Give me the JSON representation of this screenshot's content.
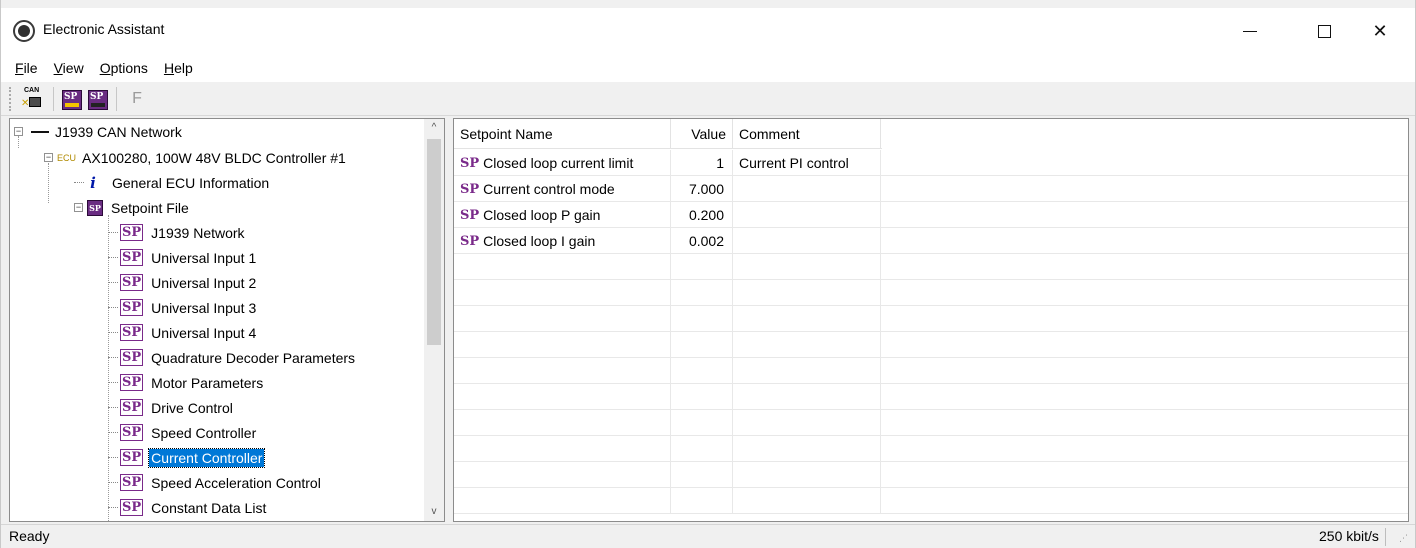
{
  "window": {
    "title": "Electronic Assistant",
    "minimize_glyph": "",
    "maximize_glyph": "",
    "close_glyph": "✕"
  },
  "menu": {
    "items": [
      {
        "first": "F",
        "rest": "ile"
      },
      {
        "first": "V",
        "rest": "iew"
      },
      {
        "first": "O",
        "rest": "ptions"
      },
      {
        "first": "H",
        "rest": "elp"
      }
    ]
  },
  "toolbar": {
    "can_label": "CAN",
    "sp_label": "SP",
    "f_label": "F"
  },
  "tree": {
    "network": "J1939 CAN Network",
    "ecu_tag": "ECU",
    "ecu": "AX100280, 100W 48V BLDC Controller #1",
    "general_info": "General ECU Information",
    "setpoint_file": "Setpoint File",
    "sp_tag": "SP",
    "expander_minus": "−",
    "scroll_up": "^",
    "scroll_down": "v",
    "items": [
      "J1939 Network",
      "Universal Input 1",
      "Universal Input 2",
      "Universal Input 3",
      "Universal Input 4",
      "Quadrature Decoder Parameters",
      "Motor Parameters",
      "Drive Control",
      "Speed Controller",
      "Current Controller",
      "Speed Acceleration Control",
      "Constant Data List"
    ],
    "selected": "Current Controller"
  },
  "grid": {
    "headers": {
      "name": "Setpoint Name",
      "value": "Value",
      "comment": "Comment"
    },
    "sp_tag": "SP",
    "rows": [
      {
        "name": "Closed loop current limit",
        "value": "1",
        "comment": "Current PI control"
      },
      {
        "name": "Current control mode",
        "value": "7.000",
        "comment": ""
      },
      {
        "name": "Closed loop P gain",
        "value": "0.200",
        "comment": ""
      },
      {
        "name": "Closed loop I gain",
        "value": "0.002",
        "comment": ""
      }
    ]
  },
  "status": {
    "left": "Ready",
    "right": "250 kbit/s"
  }
}
